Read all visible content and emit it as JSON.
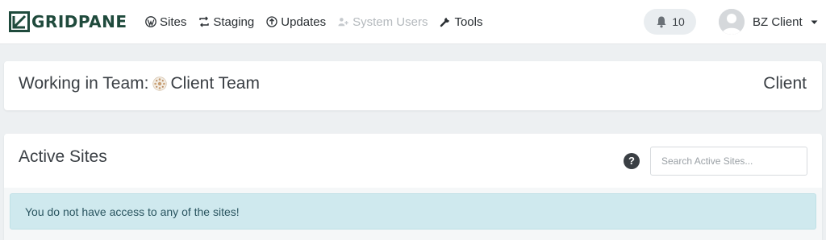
{
  "brand": {
    "name": "GRIDPANE",
    "color": "#1f4a3c"
  },
  "nav": {
    "items": [
      {
        "label": "Sites",
        "icon": "wordpress-icon",
        "enabled": true
      },
      {
        "label": "Staging",
        "icon": "sync-icon",
        "enabled": true
      },
      {
        "label": "Updates",
        "icon": "update-circle-icon",
        "enabled": true
      },
      {
        "label": "System Users",
        "icon": "users-add-icon",
        "enabled": false
      },
      {
        "label": "Tools",
        "icon": "wrench-icon",
        "enabled": true
      }
    ]
  },
  "notifications": {
    "count": "10",
    "icon": "bell-icon"
  },
  "user": {
    "name": "BZ Client",
    "icon": "chevron-down-icon"
  },
  "team": {
    "prefix": "Working in Team:",
    "name": "Client Team",
    "role": "Client"
  },
  "active_sites": {
    "title": "Active Sites",
    "help": "?",
    "search_placeholder": "Search Active Sites...",
    "search_value": "",
    "empty_message": "You do not have access to any of the sites!"
  },
  "colors": {
    "accent": "#1f4a3c",
    "alert_bg": "#cfe9ee",
    "page_bg": "#edf0f2"
  }
}
